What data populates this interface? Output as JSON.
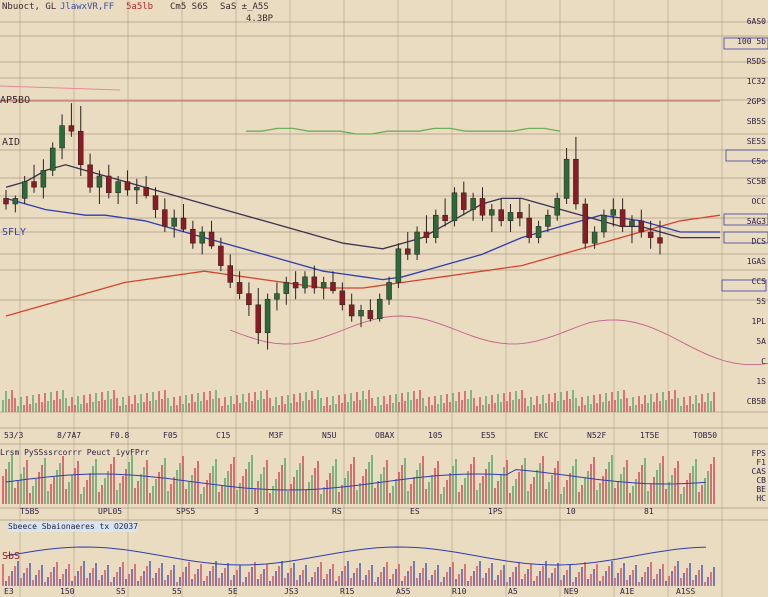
{
  "header": {
    "symbol": "Nbuoct, GL",
    "items": [
      "JlawxVR,FF",
      "5a5lb",
      "Cm5 S6S",
      "SaS ±_A5S"
    ],
    "center": "4.3BP"
  },
  "colors": {
    "background": "#eadcc0",
    "grid": "#c7b79c",
    "candle_up": "#2d6a3a",
    "candle_down": "#8a1c24",
    "ma_red": "#d8432f",
    "ma_blue": "#2f3db0",
    "ma_dark": "#3b3150",
    "ma_green": "#6fae5a",
    "volume_red": "#d8606a",
    "volume_green": "#6ab07a"
  },
  "price_panel": {
    "left_labels": [
      "AP5BO",
      "AID",
      "SFLY"
    ],
    "right_labels": [
      "6AS0",
      "100 5b",
      "R5DS",
      "1C32",
      "2GPS",
      "SB5S",
      "SE5S",
      "C5o",
      "SC5B",
      "OCC",
      "5AG3",
      "DCS",
      "1GAS",
      "CCS",
      "5S",
      "1PL",
      "5A",
      "C",
      "1S",
      "CB5B"
    ],
    "date_labels": [
      "53/3",
      "8/7A7",
      "F0.8",
      "F05",
      "C15",
      "M3F",
      "N5U",
      "OBAX",
      "105",
      "E55",
      "EKC",
      "N52F",
      "1T5E",
      "TOB50"
    ]
  },
  "volume_panel": {
    "title": "Lrsm PySSssrcorrr Peuct iyvFPrr",
    "right_labels": [
      "FPS",
      "F1",
      "CAS",
      "CB",
      "BE",
      "HC"
    ],
    "date_labels": [
      "T5B5",
      "UPL05",
      "SPS5",
      "3",
      "RS",
      "ES",
      "1PS",
      "10",
      "81"
    ]
  },
  "indicator_panel": {
    "title": "Sbeece Sbaionaeres tx O2037",
    "label": "SbS",
    "date_labels": [
      "E3",
      "150",
      "S5",
      "55",
      "5E",
      "JS3",
      "R15",
      "A55",
      "R10",
      "A5",
      "NE9",
      "A1E",
      "A1SS"
    ]
  },
  "chart_data": {
    "type": "candlestick",
    "title": "",
    "xlabel": "",
    "ylabel": "",
    "ylim": [
      0,
      100
    ],
    "grid": true,
    "candles": [
      {
        "o": 62,
        "h": 65,
        "l": 58,
        "c": 60
      },
      {
        "o": 60,
        "h": 63,
        "l": 57,
        "c": 62
      },
      {
        "o": 62,
        "h": 70,
        "l": 60,
        "c": 68
      },
      {
        "o": 68,
        "h": 74,
        "l": 64,
        "c": 66
      },
      {
        "o": 66,
        "h": 76,
        "l": 62,
        "c": 72
      },
      {
        "o": 72,
        "h": 82,
        "l": 70,
        "c": 80
      },
      {
        "o": 80,
        "h": 92,
        "l": 76,
        "c": 88
      },
      {
        "o": 88,
        "h": 96,
        "l": 84,
        "c": 86
      },
      {
        "o": 86,
        "h": 95,
        "l": 70,
        "c": 74
      },
      {
        "o": 74,
        "h": 78,
        "l": 64,
        "c": 66
      },
      {
        "o": 66,
        "h": 72,
        "l": 60,
        "c": 70
      },
      {
        "o": 70,
        "h": 74,
        "l": 62,
        "c": 64
      },
      {
        "o": 64,
        "h": 70,
        "l": 60,
        "c": 68
      },
      {
        "o": 68,
        "h": 72,
        "l": 63,
        "c": 65
      },
      {
        "o": 65,
        "h": 69,
        "l": 60,
        "c": 66
      },
      {
        "o": 66,
        "h": 70,
        "l": 62,
        "c": 63
      },
      {
        "o": 63,
        "h": 66,
        "l": 55,
        "c": 58
      },
      {
        "o": 58,
        "h": 62,
        "l": 50,
        "c": 52
      },
      {
        "o": 52,
        "h": 58,
        "l": 48,
        "c": 55
      },
      {
        "o": 55,
        "h": 60,
        "l": 50,
        "c": 51
      },
      {
        "o": 51,
        "h": 54,
        "l": 44,
        "c": 46
      },
      {
        "o": 46,
        "h": 52,
        "l": 42,
        "c": 50
      },
      {
        "o": 50,
        "h": 54,
        "l": 44,
        "c": 45
      },
      {
        "o": 45,
        "h": 48,
        "l": 36,
        "c": 38
      },
      {
        "o": 38,
        "h": 42,
        "l": 30,
        "c": 32
      },
      {
        "o": 32,
        "h": 36,
        "l": 26,
        "c": 28
      },
      {
        "o": 28,
        "h": 32,
        "l": 20,
        "c": 24
      },
      {
        "o": 24,
        "h": 30,
        "l": 10,
        "c": 14
      },
      {
        "o": 14,
        "h": 28,
        "l": 8,
        "c": 26
      },
      {
        "o": 26,
        "h": 32,
        "l": 22,
        "c": 28
      },
      {
        "o": 28,
        "h": 34,
        "l": 24,
        "c": 32
      },
      {
        "o": 32,
        "h": 36,
        "l": 26,
        "c": 30
      },
      {
        "o": 30,
        "h": 36,
        "l": 28,
        "c": 34
      },
      {
        "o": 34,
        "h": 38,
        "l": 28,
        "c": 30
      },
      {
        "o": 30,
        "h": 34,
        "l": 26,
        "c": 32
      },
      {
        "o": 32,
        "h": 36,
        "l": 28,
        "c": 29
      },
      {
        "o": 29,
        "h": 32,
        "l": 22,
        "c": 24
      },
      {
        "o": 24,
        "h": 28,
        "l": 18,
        "c": 20
      },
      {
        "o": 20,
        "h": 24,
        "l": 16,
        "c": 22
      },
      {
        "o": 22,
        "h": 26,
        "l": 18,
        "c": 19
      },
      {
        "o": 19,
        "h": 28,
        "l": 18,
        "c": 26
      },
      {
        "o": 26,
        "h": 34,
        "l": 24,
        "c": 32
      },
      {
        "o": 32,
        "h": 46,
        "l": 30,
        "c": 44
      },
      {
        "o": 44,
        "h": 50,
        "l": 40,
        "c": 42
      },
      {
        "o": 42,
        "h": 52,
        "l": 40,
        "c": 50
      },
      {
        "o": 50,
        "h": 56,
        "l": 46,
        "c": 48
      },
      {
        "o": 48,
        "h": 58,
        "l": 46,
        "c": 56
      },
      {
        "o": 56,
        "h": 62,
        "l": 52,
        "c": 54
      },
      {
        "o": 54,
        "h": 66,
        "l": 52,
        "c": 64
      },
      {
        "o": 64,
        "h": 68,
        "l": 56,
        "c": 58
      },
      {
        "o": 58,
        "h": 64,
        "l": 54,
        "c": 62
      },
      {
        "o": 62,
        "h": 66,
        "l": 54,
        "c": 56
      },
      {
        "o": 56,
        "h": 60,
        "l": 50,
        "c": 58
      },
      {
        "o": 58,
        "h": 62,
        "l": 52,
        "c": 54
      },
      {
        "o": 54,
        "h": 60,
        "l": 50,
        "c": 57
      },
      {
        "o": 57,
        "h": 62,
        "l": 52,
        "c": 55
      },
      {
        "o": 55,
        "h": 60,
        "l": 46,
        "c": 48
      },
      {
        "o": 48,
        "h": 54,
        "l": 46,
        "c": 52
      },
      {
        "o": 52,
        "h": 58,
        "l": 50,
        "c": 56
      },
      {
        "o": 56,
        "h": 64,
        "l": 54,
        "c": 62
      },
      {
        "o": 62,
        "h": 80,
        "l": 60,
        "c": 76
      },
      {
        "o": 76,
        "h": 84,
        "l": 58,
        "c": 60
      },
      {
        "o": 60,
        "h": 62,
        "l": 44,
        "c": 46
      },
      {
        "o": 46,
        "h": 52,
        "l": 44,
        "c": 50
      },
      {
        "o": 50,
        "h": 58,
        "l": 48,
        "c": 56
      },
      {
        "o": 56,
        "h": 62,
        "l": 52,
        "c": 58
      },
      {
        "o": 58,
        "h": 62,
        "l": 50,
        "c": 52
      },
      {
        "o": 52,
        "h": 56,
        "l": 46,
        "c": 54
      },
      {
        "o": 54,
        "h": 58,
        "l": 48,
        "c": 50
      },
      {
        "o": 50,
        "h": 54,
        "l": 44,
        "c": 48
      },
      {
        "o": 48,
        "h": 54,
        "l": 42,
        "c": 46
      }
    ],
    "series": [
      {
        "values": [
          20,
          22,
          24,
          26,
          28,
          30,
          32,
          33,
          34,
          35,
          36,
          35,
          34,
          33,
          32,
          31,
          30,
          30,
          30,
          31,
          32,
          33,
          34,
          35,
          36,
          37,
          38,
          40,
          42,
          44,
          46,
          48,
          50,
          52,
          54,
          55,
          56
        ]
      },
      {
        "values": [
          62,
          60,
          58,
          57,
          56,
          56,
          55,
          54,
          52,
          50,
          48,
          46,
          44,
          42,
          40,
          38,
          36,
          35,
          34,
          33,
          34,
          36,
          38,
          40,
          42,
          45,
          48,
          50,
          52,
          54,
          56,
          55,
          54,
          52,
          50,
          50,
          50
        ]
      },
      {
        "values": [
          66,
          68,
          72,
          74,
          72,
          70,
          68,
          66,
          64,
          62,
          60,
          58,
          56,
          54,
          52,
          50,
          48,
          46,
          45,
          44,
          46,
          48,
          52,
          56,
          60,
          62,
          62,
          60,
          58,
          56,
          54,
          52,
          52,
          50,
          48,
          48,
          48
        ]
      },
      {
        "values": [
          86,
          86,
          87,
          87,
          86,
          86,
          86,
          85,
          85,
          86,
          86,
          86,
          87,
          87,
          86,
          86,
          86,
          86,
          87,
          87,
          86
        ]
      }
    ]
  }
}
